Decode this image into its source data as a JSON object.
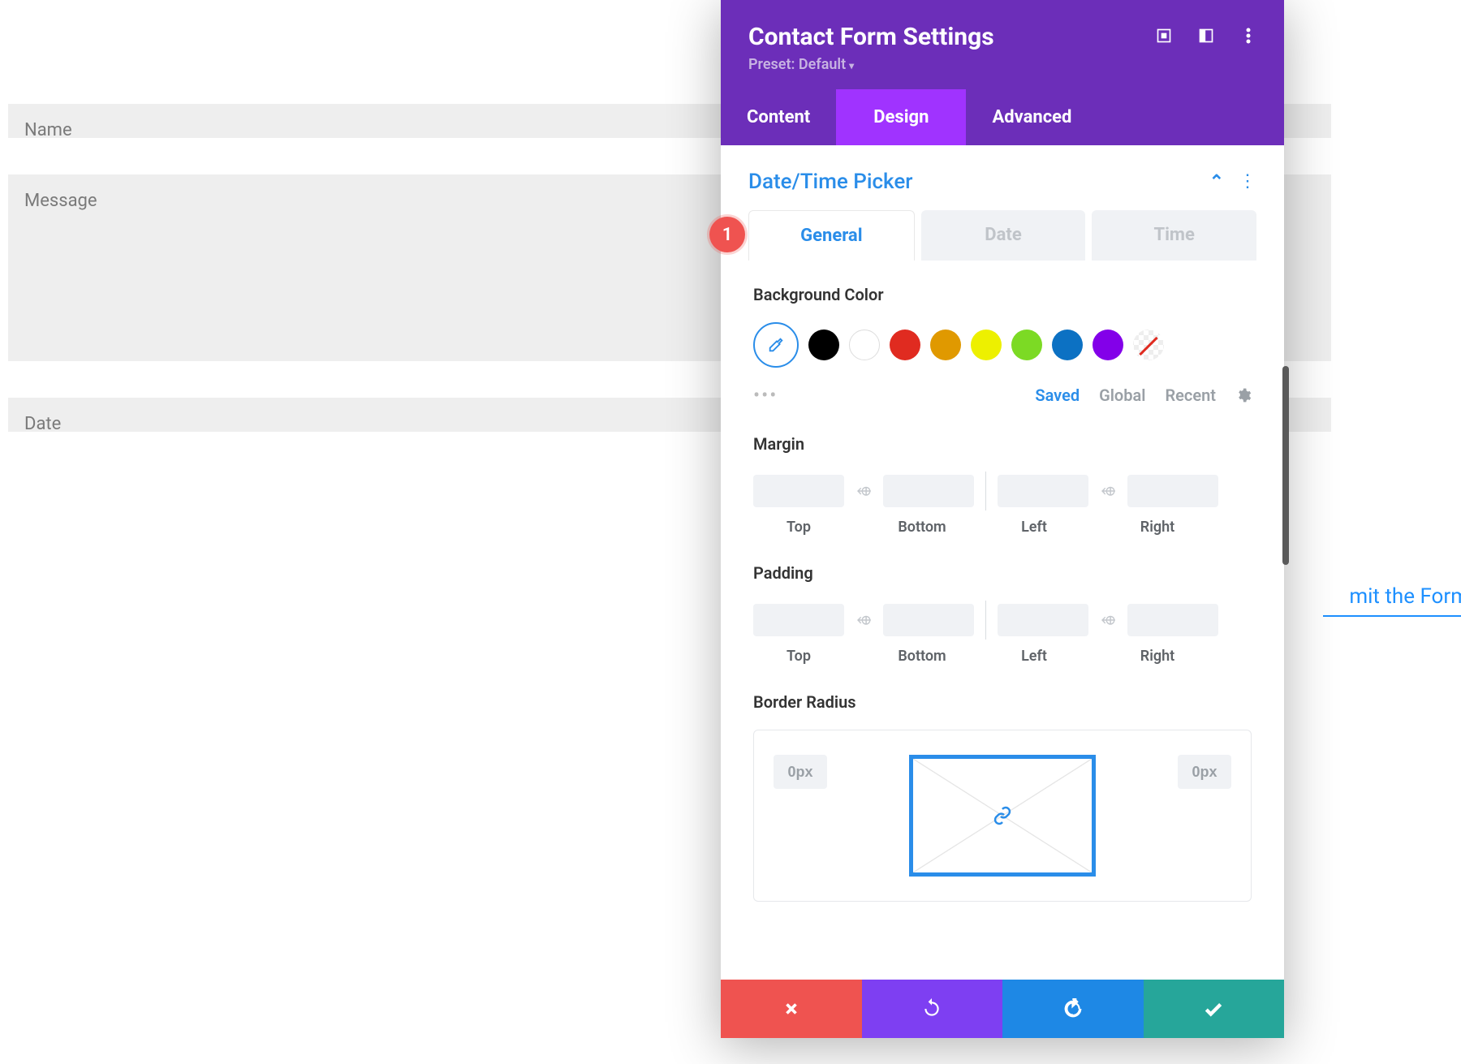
{
  "form": {
    "name_placeholder": "Name",
    "message_placeholder": "Message",
    "date_placeholder": "Date",
    "submit_text": "mit the Form"
  },
  "modal": {
    "title": "Contact Form Settings",
    "preset_label": "Preset: Default",
    "tabs": {
      "content": "Content",
      "design": "Design",
      "advanced": "Advanced"
    },
    "section_title": "Date/Time Picker",
    "subtabs": {
      "general": "General",
      "date": "Date",
      "time": "Time"
    },
    "badge": "1",
    "bg_label": "Background Color",
    "color_modes": {
      "saved": "Saved",
      "global": "Global",
      "recent": "Recent"
    },
    "margin_label": "Margin",
    "padding_label": "Padding",
    "spacing_labels": {
      "top": "Top",
      "bottom": "Bottom",
      "left": "Left",
      "right": "Right"
    },
    "border_radius_label": "Border Radius",
    "br_corner_value": "0px",
    "colors": {
      "black": "#000000",
      "white": "#ffffff",
      "red": "#e02b20",
      "orange": "#e09900",
      "yellow": "#edf000",
      "green": "#7cda24",
      "blue": "#0c71c3",
      "purple": "#8300e9"
    }
  }
}
